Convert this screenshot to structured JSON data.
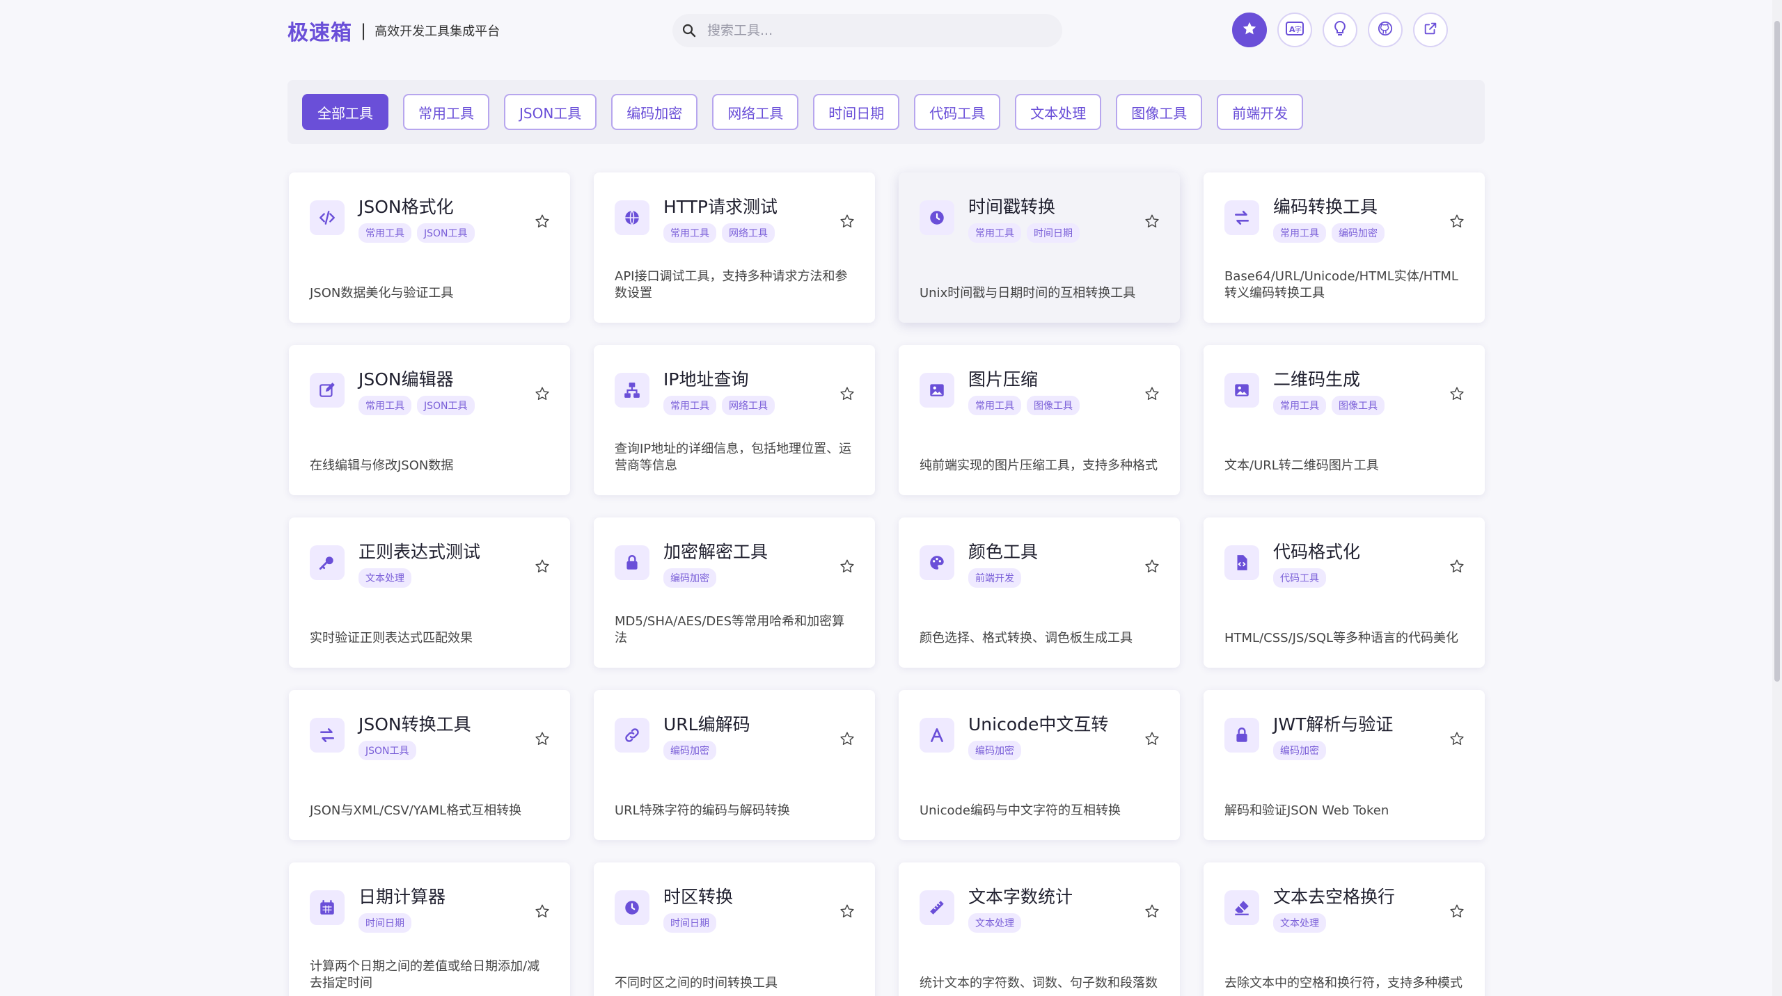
{
  "header": {
    "brand": "极速箱",
    "separator": "|",
    "subtitle": "高效开发工具集成平台",
    "search_placeholder": "搜索工具...",
    "actions": [
      {
        "name": "favorites-button",
        "icon": "star-icon"
      },
      {
        "name": "translate-button",
        "icon": "translate-icon"
      },
      {
        "name": "theme-tips-button",
        "icon": "lightbulb-icon"
      },
      {
        "name": "github-button",
        "icon": "github-icon"
      },
      {
        "name": "external-link-button",
        "icon": "external-link-icon"
      }
    ]
  },
  "categories": [
    "全部工具",
    "常用工具",
    "JSON工具",
    "编码加密",
    "网络工具",
    "时间日期",
    "代码工具",
    "文本处理",
    "图像工具",
    "前端开发"
  ],
  "active_category": "全部工具",
  "tools": [
    {
      "title": "JSON格式化",
      "icon": "code-icon",
      "tags": [
        "常用工具",
        "JSON工具"
      ],
      "desc": "JSON数据美化与验证工具"
    },
    {
      "title": "HTTP请求测试",
      "icon": "globe-icon",
      "tags": [
        "常用工具",
        "网络工具"
      ],
      "desc": "API接口调试工具，支持多种请求方法和参数设置"
    },
    {
      "title": "时间戳转换",
      "icon": "clock-icon",
      "tags": [
        "常用工具",
        "时间日期"
      ],
      "desc": "Unix时间戳与日期时间的互相转换工具"
    },
    {
      "title": "编码转换工具",
      "icon": "swap-icon",
      "tags": [
        "常用工具",
        "编码加密"
      ],
      "desc": "Base64/URL/Unicode/HTML实体/HTML转义编码转换工具"
    },
    {
      "title": "JSON编辑器",
      "icon": "edit-icon",
      "tags": [
        "常用工具",
        "JSON工具"
      ],
      "desc": "在线编辑与修改JSON数据"
    },
    {
      "title": "IP地址查询",
      "icon": "network-icon",
      "tags": [
        "常用工具",
        "网络工具"
      ],
      "desc": "查询IP地址的详细信息，包括地理位置、运营商等信息"
    },
    {
      "title": "图片压缩",
      "icon": "image-icon",
      "tags": [
        "常用工具",
        "图像工具"
      ],
      "desc": "纯前端实现的图片压缩工具，支持多种格式"
    },
    {
      "title": "二维码生成",
      "icon": "image-icon",
      "tags": [
        "常用工具",
        "图像工具"
      ],
      "desc": "文本/URL转二维码图片工具"
    },
    {
      "title": "正则表达式测试",
      "icon": "key-icon",
      "tags": [
        "文本处理"
      ],
      "desc": "实时验证正则表达式匹配效果"
    },
    {
      "title": "加密解密工具",
      "icon": "lock-icon",
      "tags": [
        "编码加密"
      ],
      "desc": "MD5/SHA/AES/DES等常用哈希和加密算法"
    },
    {
      "title": "颜色工具",
      "icon": "palette-icon",
      "tags": [
        "前端开发"
      ],
      "desc": "颜色选择、格式转换、调色板生成工具"
    },
    {
      "title": "代码格式化",
      "icon": "file-code-icon",
      "tags": [
        "代码工具"
      ],
      "desc": "HTML/CSS/JS/SQL等多种语言的代码美化"
    },
    {
      "title": "JSON转换工具",
      "icon": "swap-icon",
      "tags": [
        "JSON工具"
      ],
      "desc": "JSON与XML/CSV/YAML格式互相转换"
    },
    {
      "title": "URL编解码",
      "icon": "link-icon",
      "tags": [
        "编码加密"
      ],
      "desc": "URL特殊字符的编码与解码转换"
    },
    {
      "title": "Unicode中文互转",
      "icon": "letter-a-icon",
      "tags": [
        "编码加密"
      ],
      "desc": "Unicode编码与中文字符的互相转换"
    },
    {
      "title": "JWT解析与验证",
      "icon": "lock-icon",
      "tags": [
        "编码加密"
      ],
      "desc": "解码和验证JSON Web Token"
    },
    {
      "title": "日期计算器",
      "icon": "calendar-icon",
      "tags": [
        "时间日期"
      ],
      "desc": "计算两个日期之间的差值或给日期添加/减去指定时间"
    },
    {
      "title": "时区转换",
      "icon": "clock-icon",
      "tags": [
        "时间日期"
      ],
      "desc": "不同时区之间的时间转换工具"
    },
    {
      "title": "文本字数统计",
      "icon": "ruler-icon",
      "tags": [
        "文本处理"
      ],
      "desc": "统计文本的字符数、词数、句子数和段落数"
    },
    {
      "title": "文本去空格换行",
      "icon": "eraser-icon",
      "tags": [
        "文本处理"
      ],
      "desc": "去除文本中的空格和换行符，支持多种模式"
    }
  ],
  "highlighted_tool": "时间戳转换",
  "colors": {
    "accent": "#6a4fd8",
    "tag_bg": "#efeaff",
    "page_bg": "#f7f7fb"
  }
}
